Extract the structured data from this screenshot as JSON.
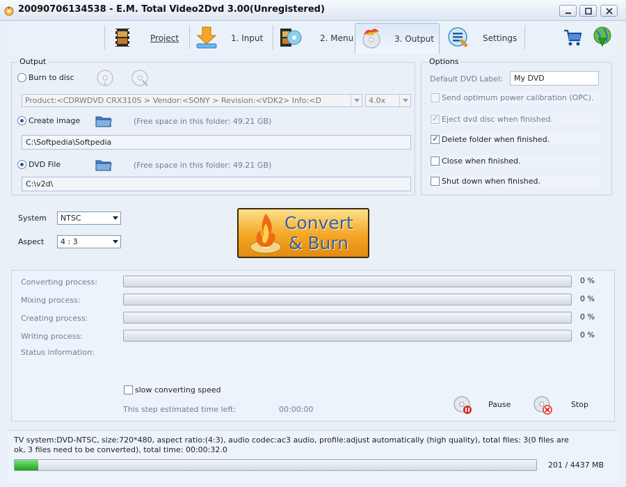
{
  "window": {
    "title": "20090706134538 - E.M. Total Video2Dvd 3.00(Unregistered)"
  },
  "tabs": [
    {
      "label": "Project"
    },
    {
      "label": "1. Input"
    },
    {
      "label": "2. Menu"
    },
    {
      "label": "3. Output"
    },
    {
      "label": "Settings"
    }
  ],
  "output": {
    "title": "Output",
    "burn_label": "Burn to disc",
    "device": "Product:<CDRWDVD CRX310S > Vendor:<SONY     > Revision:<VDK2> Info:<D",
    "speed": "4.0x",
    "create_image_label": "Create image",
    "image_free": "(Free space in this folder: 49.21 GB)",
    "image_path": "C:\\Softpedia\\Softpedia",
    "dvd_file_label": "DVD File",
    "dvd_free": "(Free space in this folder: 49.21 GB)",
    "dvd_path": "C:\\v2d\\"
  },
  "options": {
    "title": "Options",
    "dvd_label_caption": "Default DVD Label:",
    "dvd_label_value": "My DVD",
    "opc": "Send optimum power calibration (OPC).",
    "eject": "Eject dvd disc when finished.",
    "delete_folder": "Delete folder when finished.",
    "close": "Close when finished.",
    "shutdown": "Shut down when finished."
  },
  "system": {
    "label": "System",
    "value": "NTSC"
  },
  "aspect": {
    "label": "Aspect",
    "value": "4  :  3"
  },
  "convert": {
    "line1": "Convert",
    "line2": "& Burn"
  },
  "progress": {
    "converting_label": "Converting process:",
    "converting_pct": "0 %",
    "mixing_label": "Mixing process:",
    "mixing_pct": "0 %",
    "creating_label": "Creating process:",
    "creating_pct": "0 %",
    "writing_label": "Writing process:",
    "writing_pct": "0 %",
    "status_label": "Status information:",
    "slow_label": "slow converting speed",
    "eta_label": "This step estimated time left:",
    "eta_value": "00:00:00",
    "pause_label": "Pause",
    "stop_label": "Stop"
  },
  "footer": {
    "info_line1": "TV system:DVD-NTSC, size:720*480, aspect ratio:(4:3), audio codec:ac3 audio, profile:adjust automatically (high quality), total files: 3(0 files are",
    "info_line2": "ok, 3 files need to be converted), total time: 00:00:32.0",
    "disc_usage": "201 / 4437 MB",
    "disc_fill_fraction": 0.045
  },
  "colors": {
    "accent": "#1c5ea8",
    "progress_green": "#1fa31f",
    "convert_orange": "#f5a623"
  }
}
